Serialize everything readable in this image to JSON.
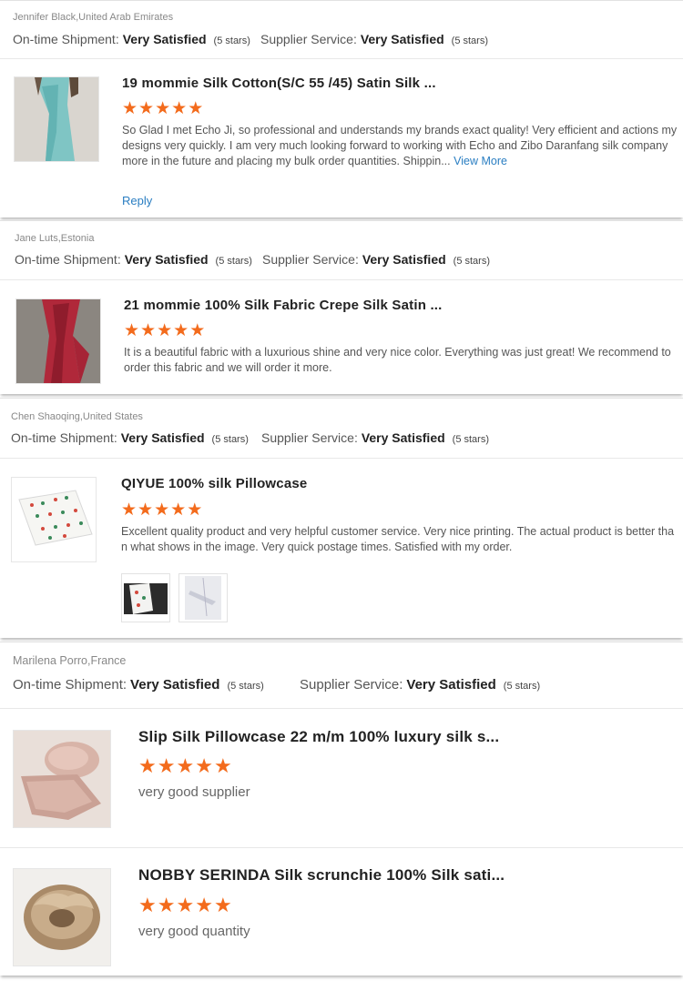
{
  "colors": {
    "star": "#f36b1c",
    "link": "#2a7ec2"
  },
  "labels": {
    "ontime": "On-time Shipment:",
    "service": "Supplier Service:",
    "very_satisfied": "Very Satisfied",
    "five_stars": "(5 stars)",
    "star_glyph": "★",
    "view_more": "View More",
    "reply": "Reply"
  },
  "reviews": [
    {
      "reviewer": "Jennifer Black,United Arab Emirates",
      "items": [
        {
          "title": "19 mommie Silk Cotton(S/C 55 /45) Satin Silk ...",
          "stars": 5,
          "text": "So Glad I met Echo Ji, so professional and understands my brands exact quality! Very efficient and actions my designs very quickly. I am very much looking forward to working with Echo and Zibo Daranfang silk company more in the future and placing my bulk order quantities. Shippin...",
          "image": "teal silk fabric drape"
        }
      ]
    },
    {
      "reviewer": "Jane Luts,Estonia",
      "items": [
        {
          "title": "21 mommie 100% Silk Fabric Crepe Silk Satin ...",
          "stars": 5,
          "text": "It is a beautiful fabric with a luxurious shine and very nice color. Everything was just great! We recommend to order this fabric and we will order it more.",
          "image": "red silk fabric drape"
        }
      ]
    },
    {
      "reviewer": "Chen Shaoqing,United States",
      "items": [
        {
          "title": "QIYUE 100% silk Pillowcase",
          "stars": 5,
          "text": "Excellent quality product and very helpful customer service. Very nice printing. The actual product is better than what shows in the image. Very quick postage times. Satisfied with my order.",
          "image": "printed silk pillowcase"
        }
      ]
    },
    {
      "reviewer": "Marilena Porro,France",
      "items": [
        {
          "title": "Slip Silk Pillowcase 22 m/m 100% luxury silk s...",
          "stars": 5,
          "text": "very good supplier",
          "image": "pink silk pillowcase"
        },
        {
          "title": "NOBBY SERINDA Silk scrunchie 100% Silk sati...",
          "stars": 5,
          "text": "very good quantity",
          "image": "champagne silk scrunchie"
        }
      ]
    }
  ]
}
